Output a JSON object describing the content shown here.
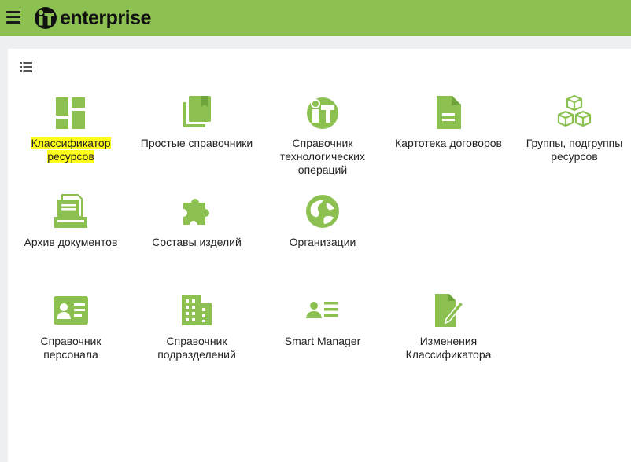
{
  "app": {
    "logo_text": "enterprise"
  },
  "tiles": [
    {
      "line1": "Классификатор",
      "line2": "ресурсов",
      "icon": "dashboard-icon",
      "highlighted": true
    },
    {
      "line1": "Простые справочники",
      "line2": "",
      "icon": "library-books-icon"
    },
    {
      "line1": "Справочник",
      "line2": "технологических",
      "line3": "операций",
      "icon": "it-logo-icon"
    },
    {
      "line1": "Картотека договоров",
      "line2": "",
      "icon": "document-icon"
    },
    {
      "line1": "Группы, подгруппы",
      "line2": "ресурсов",
      "icon": "cubes-icon"
    },
    {
      "line1": "Архив документов",
      "line2": "",
      "icon": "archive-icon"
    },
    {
      "line1": "Составы изделий",
      "line2": "",
      "icon": "puzzle-icon"
    },
    {
      "line1": "Организации",
      "line2": "",
      "icon": "globe-icon"
    },
    {
      "line1": "Справочник",
      "line2": "персонала",
      "icon": "id-card-icon"
    },
    {
      "line1": "Справочник",
      "line2": "подразделений",
      "icon": "building-icon"
    },
    {
      "line1": "Smart Manager",
      "line2": "",
      "icon": "person-list-icon"
    },
    {
      "line1": "Изменения",
      "line2": "Классификатора",
      "icon": "edit-document-icon"
    }
  ],
  "colors": {
    "accent": "#8cc152",
    "highlight": "#ffff1a"
  }
}
